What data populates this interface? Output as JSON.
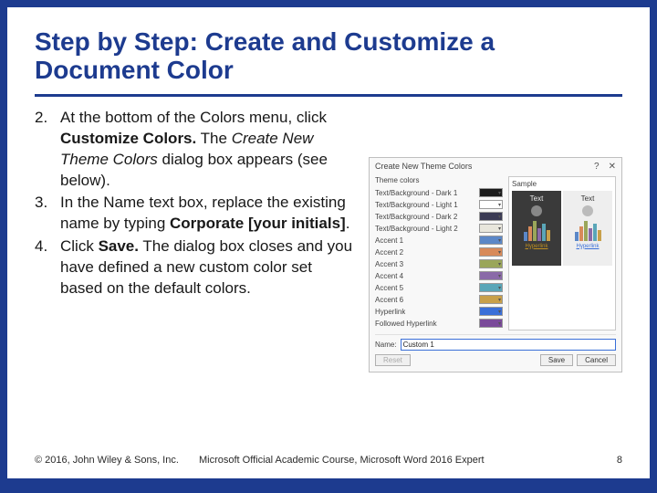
{
  "title": "Step by Step: Create and Customize a Document Color",
  "steps": [
    {
      "n": "2.",
      "html": "At the bottom of the Colors menu, click <b>Customize Colors.</b> The <i>Create New Theme Colors</i> dialog box appears (see below)."
    },
    {
      "n": "3.",
      "html": "In the Name text box, replace the existing name by typing <b>Corporate [your initials]</b>."
    },
    {
      "n": "4.",
      "html": "Click <b>Save.</b> The dialog box closes and you have defined a new custom color set based on the default colors."
    }
  ],
  "dialog": {
    "title": "Create New Theme Colors",
    "theme_label": "Theme colors",
    "sample_label": "Sample",
    "rows": [
      {
        "label": "Text/Background - Dark 1",
        "color": "#1a1a1a"
      },
      {
        "label": "Text/Background - Light 1",
        "color": "#ffffff"
      },
      {
        "label": "Text/Background - Dark 2",
        "color": "#3b3b55"
      },
      {
        "label": "Text/Background - Light 2",
        "color": "#e8e6dc"
      },
      {
        "label": "Accent 1",
        "color": "#5b87c7"
      },
      {
        "label": "Accent 2",
        "color": "#d88a5a"
      },
      {
        "label": "Accent 3",
        "color": "#9aa65a"
      },
      {
        "label": "Accent 4",
        "color": "#8a6aa8"
      },
      {
        "label": "Accent 5",
        "color": "#5aa6b8"
      },
      {
        "label": "Accent 6",
        "color": "#c8a04a"
      },
      {
        "label": "Hyperlink",
        "color": "#3a6fd8"
      },
      {
        "label": "Followed Hyperlink",
        "color": "#7a4a9a"
      }
    ],
    "sample_text": "Text",
    "sample_link": "Hyperlink",
    "name_label": "Name:",
    "name_value": "Custom 1",
    "reset": "Reset",
    "save": "Save",
    "cancel": "Cancel"
  },
  "footer": {
    "copyright": "© 2016, John Wiley & Sons, Inc.",
    "course": "Microsoft Official Academic Course, Microsoft Word 2016 Expert",
    "page": "8"
  }
}
